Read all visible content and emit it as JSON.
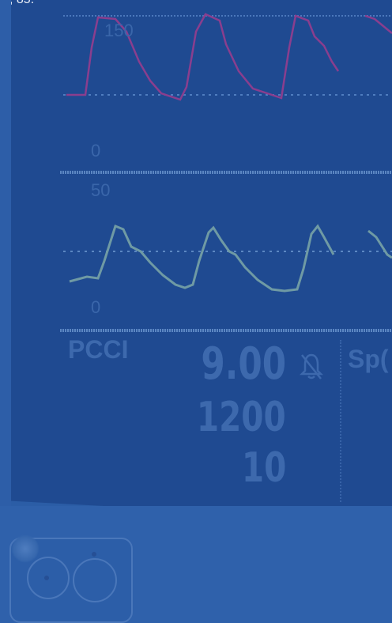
{
  "top_partial_text": ", 85.",
  "pressure_panel": {
    "scale_top": "150",
    "scale_bottom": "0",
    "colors": {
      "wave": "#8a3e8e",
      "baseline": "#4f7dbf"
    }
  },
  "cvp_panel": {
    "scale_top": "50",
    "scale_bottom": "0",
    "colors": {
      "wave": "#6f9aa4",
      "baseline": "#5c88c2"
    }
  },
  "pcci_panel": {
    "label": "PCCI",
    "value_main": "9.00",
    "value_second": "1200",
    "value_third": "10",
    "alarm_icon": "bell-off-icon"
  },
  "spo2_panel": {
    "label_partial": "Sp("
  }
}
